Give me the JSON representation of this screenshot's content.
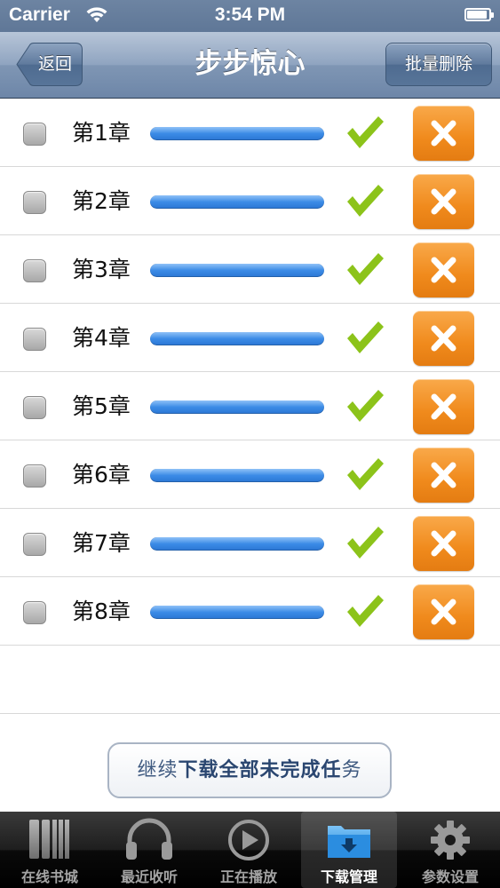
{
  "status_bar": {
    "carrier": "Carrier",
    "time": "3:54 PM"
  },
  "nav": {
    "back_label": "返回",
    "title": "步步惊心",
    "batch_delete_label": "批量删除"
  },
  "chapters": [
    {
      "label": "第1章",
      "progress": 1.0,
      "completed": true
    },
    {
      "label": "第2章",
      "progress": 1.0,
      "completed": true
    },
    {
      "label": "第3章",
      "progress": 1.0,
      "completed": true
    },
    {
      "label": "第4章",
      "progress": 1.0,
      "completed": true
    },
    {
      "label": "第5章",
      "progress": 1.0,
      "completed": true
    },
    {
      "label": "第6章",
      "progress": 1.0,
      "completed": true
    },
    {
      "label": "第7章",
      "progress": 1.0,
      "completed": true
    },
    {
      "label": "第8章",
      "progress": 1.0,
      "completed": true
    }
  ],
  "continue_button": {
    "label": "继续下载全部未完成任务"
  },
  "tabs": [
    {
      "label": "在线书城",
      "icon": "books-icon",
      "active": false
    },
    {
      "label": "最近收听",
      "icon": "headphones-icon",
      "active": false
    },
    {
      "label": "正在播放",
      "icon": "play-icon",
      "active": false
    },
    {
      "label": "下载管理",
      "icon": "download-folder-icon",
      "active": true
    },
    {
      "label": "参数设置",
      "icon": "gear-icon",
      "active": false
    }
  ],
  "colors": {
    "accent_orange": "#f08a1c",
    "check_green": "#8cc31a",
    "progress_blue": "#3b8be6",
    "nav_blue": "#7f96b4"
  }
}
